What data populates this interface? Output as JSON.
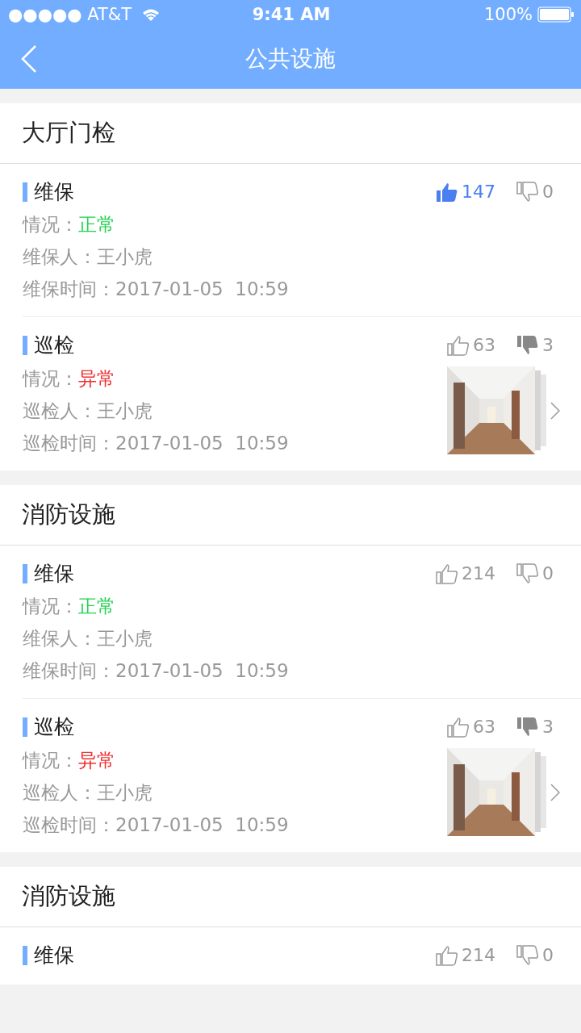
{
  "status_bar": {
    "carrier": "●●●●● AT&T",
    "time": "9:41 AM",
    "battery": "100%"
  },
  "nav": {
    "title": "公共设施"
  },
  "sections": [
    {
      "title": "大厅门检",
      "records": [
        {
          "title": "维保",
          "likes": "147",
          "liked": true,
          "dislikes": "0",
          "disliked": false,
          "status_label": "情况：",
          "status": "正常",
          "ok": true,
          "person": "维保人：王小虎",
          "time": "维保时间：2017-01-05  10:59",
          "photo": false
        },
        {
          "title": "巡检",
          "likes": "63",
          "liked": false,
          "dislikes": "3",
          "disliked": true,
          "status_label": "情况：",
          "status": "异常",
          "ok": false,
          "person": "巡检人：王小虎",
          "time": "巡检时间：2017-01-05  10:59",
          "photo": true
        }
      ]
    },
    {
      "title": "消防设施",
      "records": [
        {
          "title": "维保",
          "likes": "214",
          "liked": false,
          "dislikes": "0",
          "disliked": false,
          "status_label": "情况：",
          "status": "正常",
          "ok": true,
          "person": "维保人：王小虎",
          "time": "维保时间：2017-01-05  10:59",
          "photo": false
        },
        {
          "title": "巡检",
          "likes": "63",
          "liked": false,
          "dislikes": "3",
          "disliked": true,
          "status_label": "情况：",
          "status": "异常",
          "ok": false,
          "person": "巡检人：王小虎",
          "time": "巡检时间：2017-01-05  10:59",
          "photo": true
        }
      ]
    },
    {
      "title": "消防设施",
      "records": [
        {
          "title": "维保",
          "likes": "214",
          "liked": false,
          "dislikes": "0",
          "disliked": false
        }
      ]
    }
  ]
}
